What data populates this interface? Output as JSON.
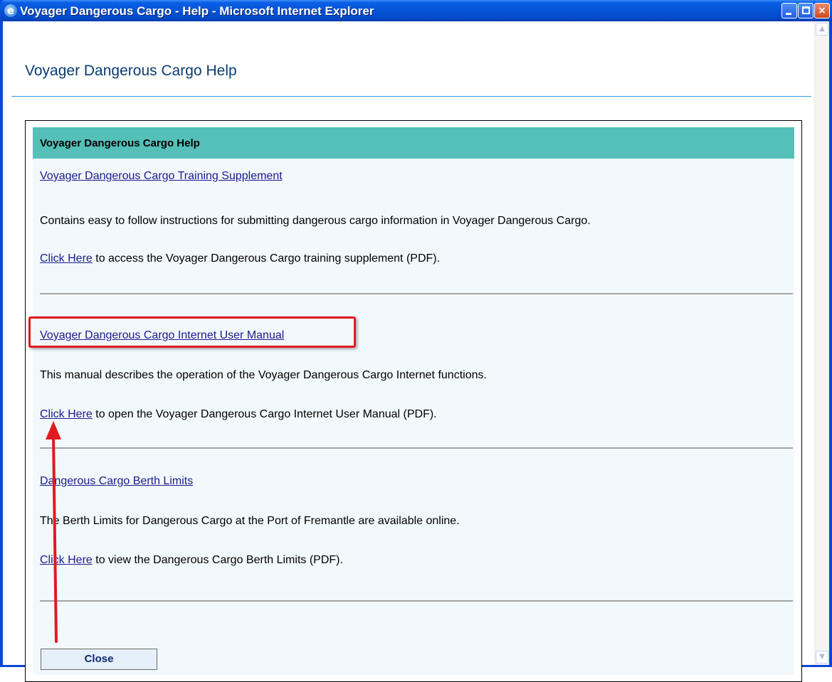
{
  "window": {
    "title": "Voyager Dangerous Cargo - Help - Microsoft Internet Explorer",
    "icon": "ie-icon",
    "buttons": {
      "minimize": "minimize-icon",
      "maximize": "maximize-icon",
      "close": "×"
    }
  },
  "page": {
    "heading": "Voyager Dangerous Cargo Help"
  },
  "panel": {
    "header": "Voyager Dangerous Cargo Help",
    "sections": [
      {
        "title": "Voyager Dangerous Cargo Training Supplement",
        "description": "Contains easy to follow instructions for submitting dangerous cargo information in Voyager Dangerous Cargo.",
        "link_label": "Click Here",
        "link_suffix": " to access the Voyager Dangerous Cargo training supplement (PDF)."
      },
      {
        "title": "Voyager Dangerous Cargo Internet User Manual",
        "description": "This manual describes the operation of the Voyager Dangerous Cargo Internet functions.",
        "link_label": "Click Here",
        "link_suffix": " to open the Voyager Dangerous Cargo Internet User Manual (PDF)."
      },
      {
        "title": "Dangerous Cargo Berth Limits",
        "description": "The Berth Limits for Dangerous Cargo at the Port of Fremantle are available online.",
        "link_label": "Click Here",
        "link_suffix": " to view the Dangerous Cargo Berth Limits (PDF)."
      }
    ],
    "close_label": "Close"
  },
  "annotations": {
    "highlight_color": "#e01a22",
    "arrow_color": "#e01a22"
  },
  "colors": {
    "titlebar": "#0653d6",
    "panel_header": "#54c0b8",
    "panel_bg": "#f2f9fc",
    "heading": "#0b3c6f",
    "link": "#1a1a8c"
  }
}
